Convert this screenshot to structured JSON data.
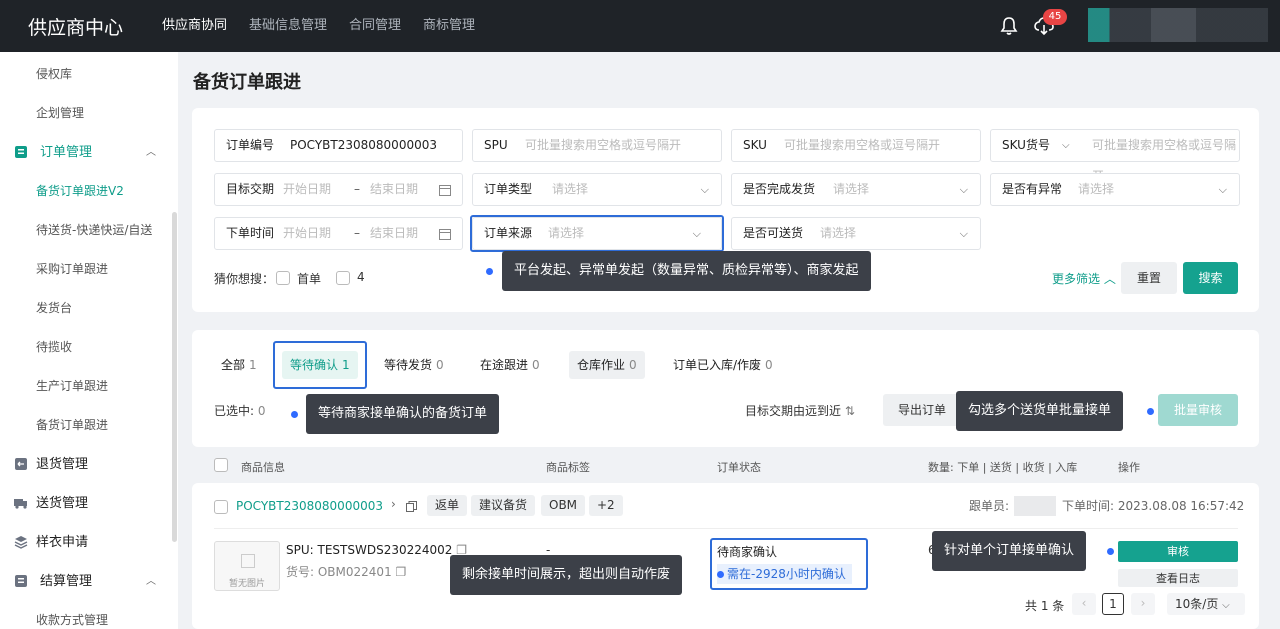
{
  "header": {
    "brand": "供应商中心",
    "nav": [
      "供应商协同",
      "基础信息管理",
      "合同管理",
      "商标管理"
    ],
    "notification_count": "45"
  },
  "sidebar": {
    "items": [
      {
        "label": "侵权库"
      },
      {
        "label": "企划管理"
      },
      {
        "label": "订单管理",
        "expand": "︿"
      },
      {
        "label": "备货订单跟进V2"
      },
      {
        "label": "待送货-快递快运/自送"
      },
      {
        "label": "采购订单跟进"
      },
      {
        "label": "发货台"
      },
      {
        "label": "待揽收"
      },
      {
        "label": "生产订单跟进"
      },
      {
        "label": "备货订单跟进"
      },
      {
        "label": "退货管理"
      },
      {
        "label": "送货管理"
      },
      {
        "label": "样衣申请"
      },
      {
        "label": "结算管理",
        "expand": "︿"
      },
      {
        "label": "收款方式管理"
      }
    ]
  },
  "page": {
    "title": "备货订单跟进"
  },
  "filters": {
    "order_no": {
      "label": "订单编号",
      "value": "POCYBT2308080000003"
    },
    "spu": {
      "label": "SPU",
      "placeholder": "可批量搜索用空格或逗号隔开"
    },
    "sku": {
      "label": "SKU",
      "placeholder": "可批量搜索用空格或逗号隔开"
    },
    "sku_code": {
      "label": "SKU货号",
      "placeholder": "可批量搜索用空格或逗号隔开"
    },
    "target_date": {
      "label": "目标交期",
      "start": "开始日期",
      "sep": "–",
      "end": "结束日期"
    },
    "order_type": {
      "label": "订单类型",
      "placeholder": "请选择"
    },
    "delivered": {
      "label": "是否完成发货",
      "placeholder": "请选择"
    },
    "abnormal": {
      "label": "是否有异常",
      "placeholder": "请选择"
    },
    "order_time": {
      "label": "下单时间",
      "start": "开始日期",
      "sep": "–",
      "end": "结束日期"
    },
    "source": {
      "label": "订单来源",
      "placeholder": "请选择"
    },
    "deliverable": {
      "label": "是否可送货",
      "placeholder": "请选择"
    },
    "guess": {
      "label": "猜你想搜：",
      "options": [
        "首单",
        "4"
      ]
    },
    "more": "更多筛选",
    "reset": "重置",
    "search": "搜索"
  },
  "tips": {
    "source": "平台发起、异常单发起（数量异常、质检异常等）、商家发起",
    "pending": "等待商家接单确认的备货订单",
    "batch": "勾选多个送货单批量接单",
    "single": "针对单个订单接单确认",
    "remain": "剩余接单时间展示，超出则自动作废"
  },
  "tabs": [
    {
      "label": "全部",
      "count": "1"
    },
    {
      "label": "等待确认",
      "count": "1"
    },
    {
      "label": "等待发货",
      "count": "0"
    },
    {
      "label": "在途跟进",
      "count": "0"
    },
    {
      "label": "仓库作业",
      "count": "0"
    },
    {
      "label": "订单已入库/作废",
      "count": "0"
    }
  ],
  "toolbar": {
    "selected_label": "已选中:",
    "selected_count": "0",
    "sort": "目标交期由远到近",
    "export": "导出订单",
    "batch_audit": "批量审核"
  },
  "table": {
    "columns": [
      "商品信息",
      "商品标签",
      "订单状态",
      "数量: 下单 | 送货 | 收货 | 入库",
      "操作"
    ]
  },
  "order": {
    "order_no": "POCYBT2308080000003",
    "tags": [
      "返单",
      "建议备货",
      "OBM",
      "+2"
    ],
    "follower_label": "跟单员:",
    "time_label": "下单时间:",
    "time": "2023.08.08 16:57:42",
    "thumb_text": "暂无图片",
    "spu": "SPU: TESTSWDS230224002",
    "sku": "货号: OBM022401",
    "tag_value": "-",
    "status": "待商家确认",
    "remain": "需在-2928小时内确认",
    "qty": "6",
    "audit": "审核",
    "log": "查看日志"
  },
  "pager": {
    "total": "共 1 条",
    "prev": "‹",
    "page": "1",
    "next": "›",
    "size": "10条/页"
  }
}
